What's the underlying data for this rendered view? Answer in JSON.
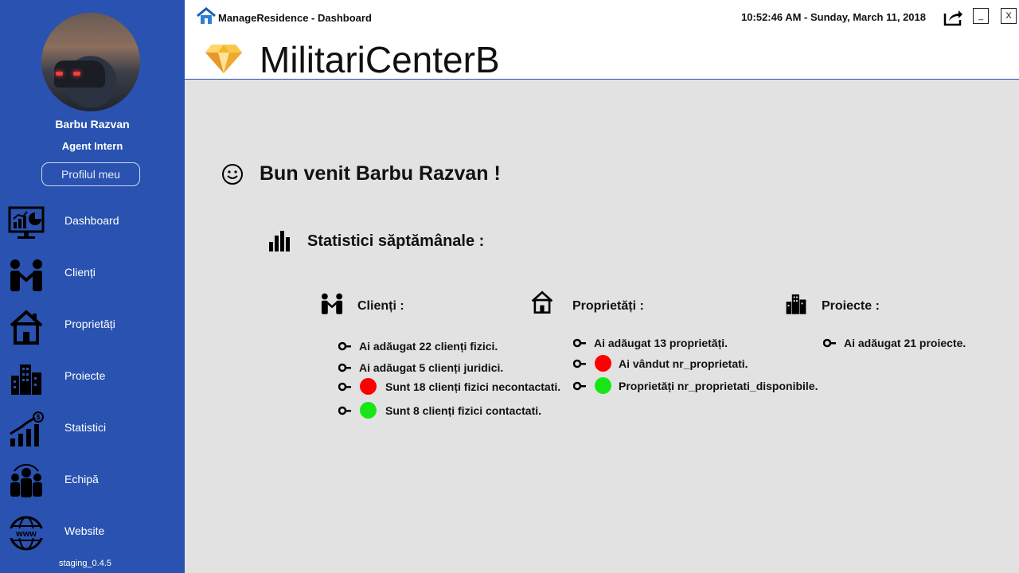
{
  "sidebar": {
    "user_name": "Barbu Razvan",
    "user_role": "Agent Intern",
    "profile_button": "Profilul meu",
    "items": [
      {
        "label": "Dashboard",
        "icon": "dashboard-monitor-icon"
      },
      {
        "label": "Clienți",
        "icon": "handshake-icon"
      },
      {
        "label": "Proprietăți",
        "icon": "house-icon"
      },
      {
        "label": "Proiecte",
        "icon": "buildings-icon"
      },
      {
        "label": "Statistici",
        "icon": "growth-chart-icon"
      },
      {
        "label": "Echipă",
        "icon": "team-icon"
      },
      {
        "label": "Website",
        "icon": "www-globe-icon"
      }
    ],
    "version": "staging_0.4.5"
  },
  "titlebar": {
    "app_title": "ManageResidence - Dashboard",
    "datetime": "10:52:46 AM - Sunday, March 11, 2018",
    "minimize_label": "_",
    "close_label": "X"
  },
  "header": {
    "company_name": "MilitariCenterB"
  },
  "main": {
    "welcome": "Bun venit Barbu Razvan !",
    "stats_title": "Statistici săptămânale :",
    "sections": {
      "clienti": {
        "title": "Clienți :",
        "lines": [
          "Ai adăugat 22 clienți fizici.",
          "Ai adăugat 5 clienți juridici.",
          "Sunt  18 clienți fizici necontactati.",
          "Sunt 8 clienți fizici contactati."
        ]
      },
      "proprietati": {
        "title": "Proprietăți :",
        "lines": [
          "Ai adăugat  13 proprietăți.",
          "Ai vândut  nr_proprietati.",
          "Proprietăți  nr_proprietati_disponibile."
        ]
      },
      "proiecte": {
        "title": "Proiecte :",
        "lines": [
          "Ai adăugat 21 proiecte."
        ]
      }
    }
  },
  "colors": {
    "sidebar_bg": "#2a52b0",
    "status_red": "#ff0000",
    "status_green": "#16e616",
    "content_bg": "#e2e2e2"
  }
}
